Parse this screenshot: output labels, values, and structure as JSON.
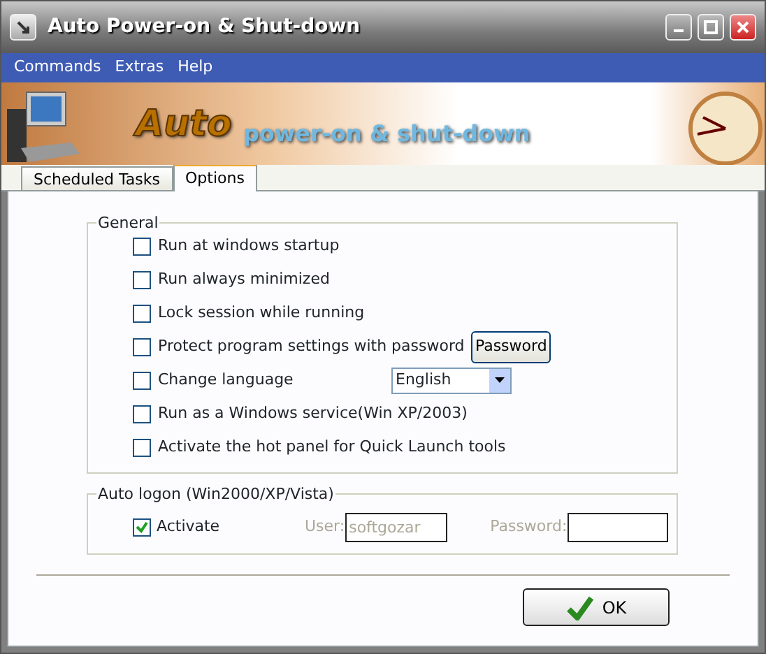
{
  "window": {
    "title": "Auto Power-on & Shut-down"
  },
  "menu": [
    "Commands",
    "Extras",
    "Help"
  ],
  "banner": {
    "title": "Auto",
    "subtitle": "power-on & shut-down"
  },
  "tabs": [
    {
      "label": "Scheduled Tasks",
      "selected": false
    },
    {
      "label": "Options",
      "selected": true
    }
  ],
  "general": {
    "title": "General",
    "options": [
      {
        "kind": "checkbox",
        "label": "Run at windows startup",
        "checked": false
      },
      {
        "kind": "checkbox",
        "label": "Run always minimized",
        "checked": false
      },
      {
        "kind": "checkbox",
        "label": "Lock session while running",
        "checked": false
      },
      {
        "kind": "button",
        "label": "Protect program settings with password",
        "checked": false,
        "button": "Password"
      },
      {
        "kind": "select",
        "label": "Change language",
        "checked": false,
        "value": "English"
      },
      {
        "kind": "checkbox",
        "label": "Run as a  Windows service(Win XP/2003)",
        "checked": false
      },
      {
        "kind": "checkbox",
        "label": "Activate the hot panel for Quick Launch tools",
        "checked": false
      }
    ]
  },
  "auto_logon": {
    "title": "Auto logon (Win2000/XP/Vista)",
    "activate": {
      "label": "Activate",
      "checked": true
    },
    "user": {
      "label": "User:",
      "value": "softgozar",
      "disabled": true
    },
    "password": {
      "label": "Password:",
      "disabled": true
    }
  },
  "ok_button": "OK"
}
